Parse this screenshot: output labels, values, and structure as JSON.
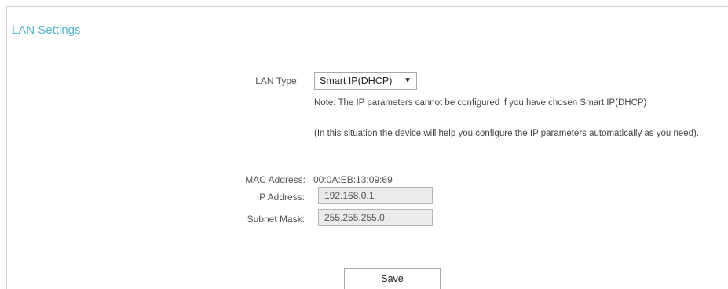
{
  "panel": {
    "title": "LAN Settings"
  },
  "lan_type": {
    "label": "LAN Type:",
    "selected": "Smart IP(DHCP)",
    "arrow_icon": "caret-down-icon"
  },
  "notes": {
    "line1": "Note: The IP parameters cannot be configured if you have chosen Smart IP(DHCP)",
    "line2": "(In this situation the device will help you configure the IP parameters automatically as you need)."
  },
  "mac_address": {
    "label": "MAC Address:",
    "value": "00:0A:EB:13:09:69"
  },
  "ip_address": {
    "label": "IP Address:",
    "value": "192.168.0.1"
  },
  "subnet_mask": {
    "label": "Subnet Mask:",
    "value": "255.255.255.0"
  },
  "actions": {
    "save_label": "Save"
  },
  "colors": {
    "title": "#4fb7c9",
    "disabled_field_bg": "#ebebeb",
    "border": "#cfcfcf"
  }
}
